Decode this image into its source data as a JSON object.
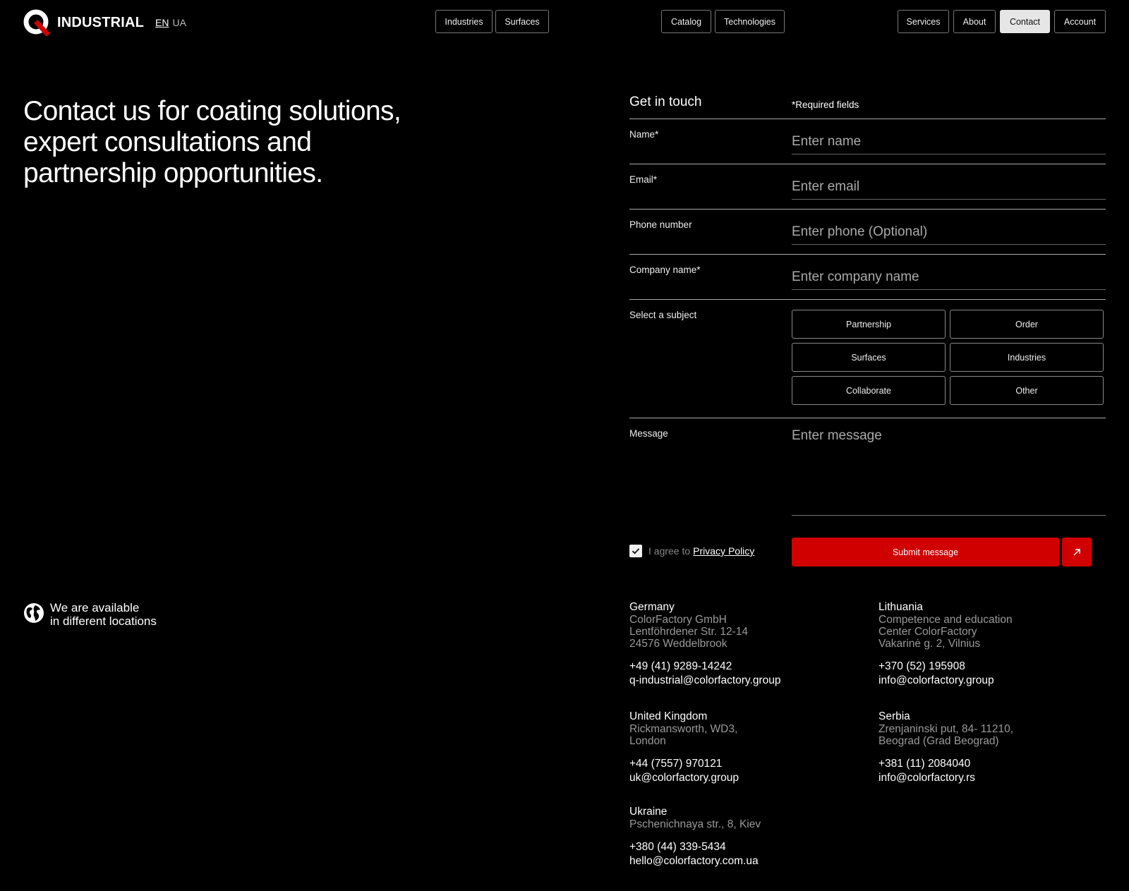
{
  "brand": {
    "name": "INDUSTRIAL",
    "logo_icon": "q-logo-icon",
    "accent": "#d00000"
  },
  "lang": {
    "active": "EN",
    "other": "UA"
  },
  "nav": {
    "industries": "Industries",
    "surfaces": "Surfaces",
    "catalog": "Catalog",
    "technologies": "Technologies",
    "services": "Services",
    "about": "About",
    "contact": "Contact",
    "account": "Account"
  },
  "hero": {
    "line1": "Contact us for coating solutions,",
    "line2": "expert consultations and",
    "line3": "partnership opportunities."
  },
  "form": {
    "title": "Get in touch",
    "required_note": "*Required fields",
    "name": {
      "label": "Name*",
      "placeholder": "Enter name"
    },
    "email": {
      "label": "Email*",
      "placeholder": "Enter email"
    },
    "phone": {
      "label": "Phone number",
      "placeholder": "Enter phone (Optional)"
    },
    "company": {
      "label": "Company name*",
      "placeholder": "Enter company name"
    },
    "subject": {
      "label": "Select a subject",
      "options": [
        "Partnership",
        "Order",
        "Surfaces",
        "Industries",
        "Collaborate",
        "Other"
      ]
    },
    "message": {
      "label": "Message",
      "placeholder": "Enter message"
    },
    "agree_prefix": "I agree to",
    "privacy_link": "Privacy Policy",
    "agree_checked": true,
    "submit_label": "Submit message"
  },
  "locations_intro": {
    "line1": "We are available",
    "line2": "in different locations"
  },
  "locations": {
    "germany": {
      "country": "Germany",
      "addr1": "ColorFactory GmbH",
      "addr2": "Lentföhrdener Str. 12-14",
      "addr3": "24576 Weddelbrook",
      "phone": "+49 (41) 9289-14242",
      "email": "q-industrial@colorfactory.group"
    },
    "lithuania": {
      "country": "Lithuania",
      "addr1": "Competence and education",
      "addr2": "Center ColorFactory",
      "addr3": "Vakarinė g. 2, Vilnius",
      "phone": "+370 (52) 195908",
      "email": "info@colorfactory.group"
    },
    "uk": {
      "country": "United Kingdom",
      "addr1": "Rickmansworth, WD3,",
      "addr2": "London",
      "phone": "+44 (7557) 970121",
      "email": "uk@colorfactory.group"
    },
    "serbia": {
      "country": "Serbia",
      "addr1": "Zrenjaninski put, 84- 11210,",
      "addr2": "Beograd (Grad Beograd)",
      "phone": "+381 (11) 2084040",
      "email": "info@colorfactory.rs"
    },
    "ukraine": {
      "country": "Ukraine",
      "addr1": "Pschenichnaya str., 8, Kiev",
      "phone": "+380 (44) 339-5434",
      "email": "hello@colorfactory.com.ua"
    }
  }
}
